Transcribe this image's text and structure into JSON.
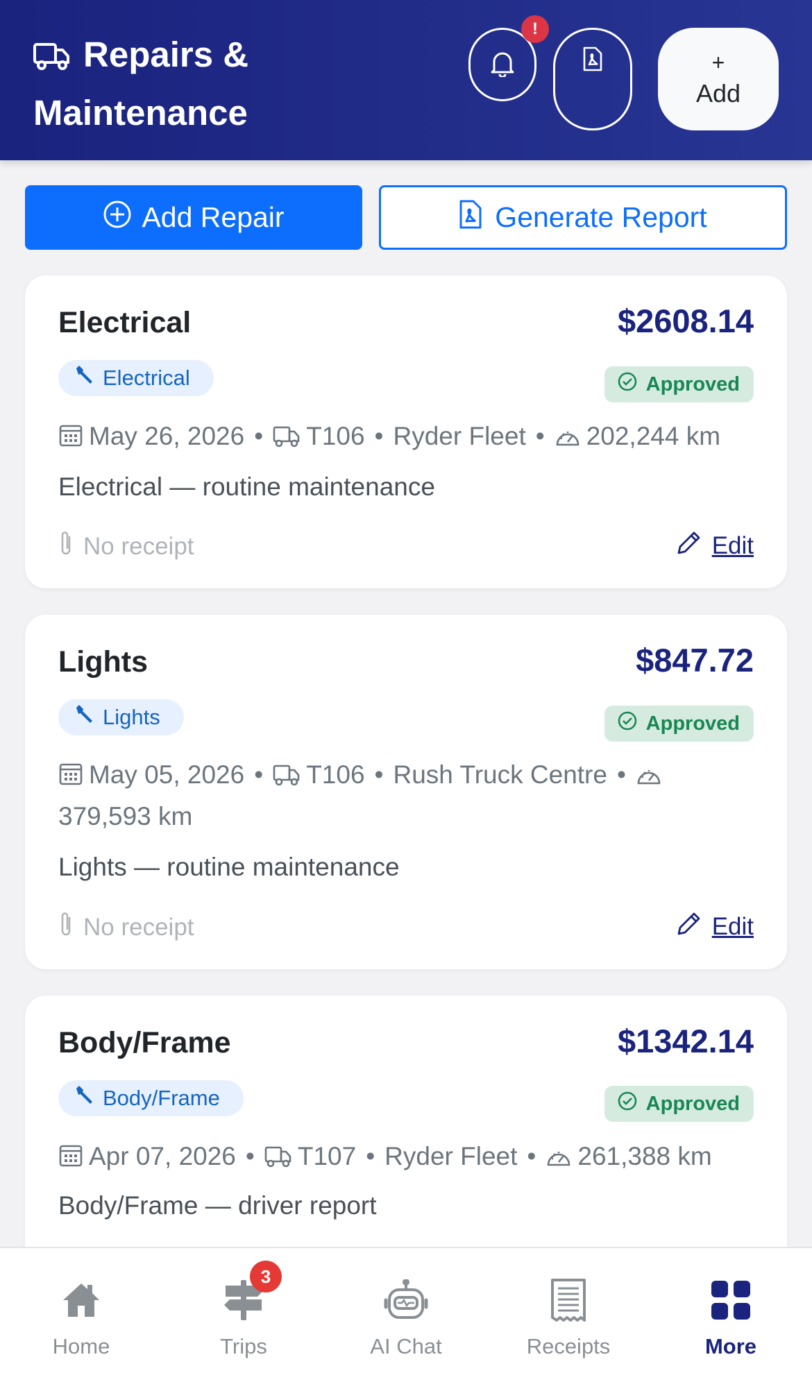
{
  "header": {
    "title_line1": "Repairs &",
    "title_line2": "Maintenance",
    "add_plus": "+",
    "add_label": "Add",
    "alert_badge": "!"
  },
  "actions": {
    "add_repair": "Add Repair",
    "generate_report": "Generate Report"
  },
  "repairs": [
    {
      "title": "Electrical",
      "amount": "$2608.14",
      "category": "Electrical",
      "status": "Approved",
      "date": "May 26, 2026",
      "truck": "T106",
      "vendor": "Ryder Fleet",
      "odometer": "202,244 km",
      "description": "Electrical — routine maintenance",
      "receipt": "No receipt",
      "edit": "Edit"
    },
    {
      "title": "Lights",
      "amount": "$847.72",
      "category": "Lights",
      "status": "Approved",
      "date": "May 05, 2026",
      "truck": "T106",
      "vendor": "Rush Truck Centre",
      "odometer": "379,593 km",
      "description": "Lights — routine maintenance",
      "receipt": "No receipt",
      "edit": "Edit"
    },
    {
      "title": "Body/Frame",
      "amount": "$1342.14",
      "category": "Body/Frame",
      "status": "Approved",
      "date": "Apr 07, 2026",
      "truck": "T107",
      "vendor": "Ryder Fleet",
      "odometer": "261,388 km",
      "description": "Body/Frame — driver report"
    }
  ],
  "nav": {
    "items": [
      {
        "label": "Home",
        "icon": "home-icon"
      },
      {
        "label": "Trips",
        "icon": "signpost-icon",
        "badge": "3"
      },
      {
        "label": "AI Chat",
        "icon": "robot-icon"
      },
      {
        "label": "Receipts",
        "icon": "receipt-icon"
      },
      {
        "label": "More",
        "icon": "grid-icon",
        "active": true
      }
    ]
  },
  "colors": {
    "header": "#1a237e",
    "primary": "#0d6efd",
    "amount": "#1a237e",
    "approved": "#198754",
    "badge": "#e53935"
  }
}
